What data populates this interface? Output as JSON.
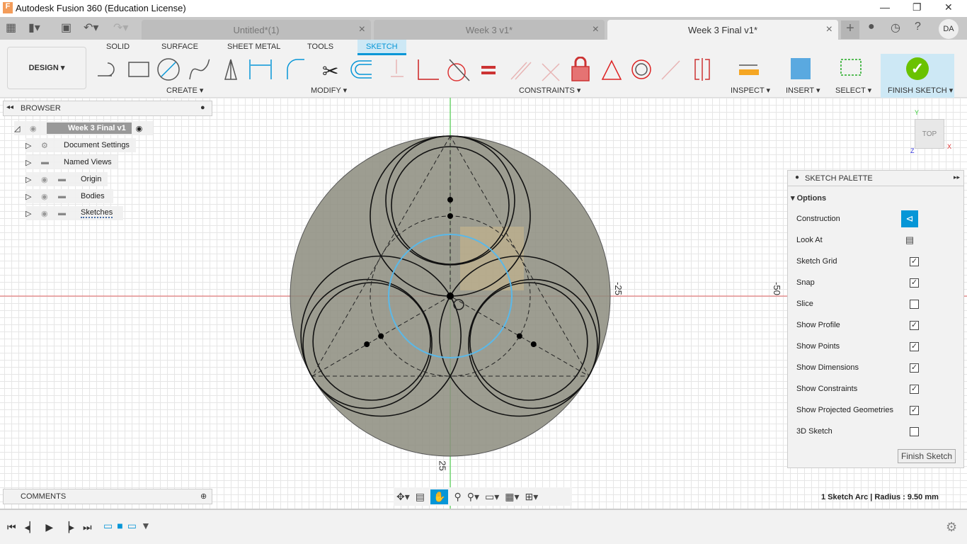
{
  "window": {
    "title": "Autodesk Fusion 360 (Education License)",
    "minimize": "—",
    "restore": "❐",
    "close": "✕"
  },
  "tabs": [
    {
      "label": "Untitled*(1)",
      "active": false
    },
    {
      "label": "Week 3 v1*",
      "active": false
    },
    {
      "label": "Week 3 Final v1*",
      "active": true
    }
  ],
  "user": {
    "initials": "DA"
  },
  "ribbon": {
    "workspace": "DESIGN ▾",
    "tabs": [
      "SOLID",
      "SURFACE",
      "SHEET METAL",
      "TOOLS",
      "SKETCH"
    ],
    "active_tab": "SKETCH",
    "groups": {
      "create": "CREATE ▾",
      "modify": "MODIFY ▾",
      "constraints": "CONSTRAINTS ▾",
      "inspect": "INSPECT ▾",
      "insert": "INSERT ▾",
      "select": "SELECT ▾",
      "finish": "FINISH SKETCH ▾"
    }
  },
  "browser": {
    "title": "BROWSER",
    "root": "Week 3 Final v1",
    "items": [
      "Document Settings",
      "Named Views",
      "Origin",
      "Bodies",
      "Sketches"
    ]
  },
  "comments": {
    "title": "COMMENTS"
  },
  "viewcube": {
    "face": "TOP",
    "x": "X",
    "y": "Y",
    "z": "Z"
  },
  "axis_labels": {
    "right": "-25",
    "far_right": "-50",
    "bottom": "25"
  },
  "palette": {
    "title": "SKETCH PALETTE",
    "section": "Options",
    "options": [
      {
        "label": "Construction",
        "type": "button",
        "active": true
      },
      {
        "label": "Look At",
        "type": "button"
      },
      {
        "label": "Sketch Grid",
        "checked": true
      },
      {
        "label": "Snap",
        "checked": true
      },
      {
        "label": "Slice",
        "checked": false
      },
      {
        "label": "Show Profile",
        "checked": true
      },
      {
        "label": "Show Points",
        "checked": true
      },
      {
        "label": "Show Dimensions",
        "checked": true
      },
      {
        "label": "Show Constraints",
        "checked": true
      },
      {
        "label": "Show Projected Geometries",
        "checked": true
      },
      {
        "label": "3D Sketch",
        "checked": false
      }
    ],
    "finish": "Finish Sketch"
  },
  "status": "1 Sketch Arc | Radius : 9.50 mm",
  "colors": {
    "accent": "#0696d7",
    "finish_green": "#6ac200",
    "selection_blue": "#5bb8e8",
    "profile_fill": "#8c8c7e"
  }
}
